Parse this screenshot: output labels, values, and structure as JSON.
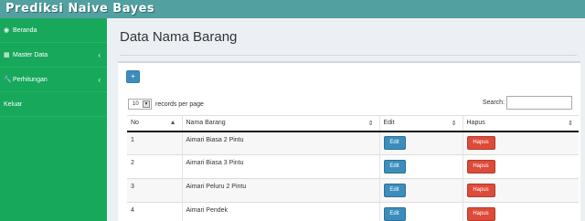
{
  "app": {
    "title": "Prediksi Naive Bayes"
  },
  "sidebar": {
    "items": [
      {
        "label": "Beranda",
        "icon": "dashboard-icon",
        "has_submenu": false
      },
      {
        "label": "Master Data",
        "icon": "table-icon",
        "has_submenu": true
      },
      {
        "label": "Perhitungan",
        "icon": "wrench-icon",
        "has_submenu": true
      },
      {
        "label": "Keluar",
        "icon": "",
        "has_submenu": false
      }
    ]
  },
  "page": {
    "title": "Data Nama Barang"
  },
  "toolbar": {
    "add_label": "+"
  },
  "datatable": {
    "length_value": "10",
    "length_label": "records per page",
    "search_label": "Search:",
    "search_value": "",
    "columns": [
      "No",
      "Nama Barang",
      "Edit",
      "Hapus"
    ],
    "rows": [
      {
        "no": "1",
        "nama": "Aimari Biasa 2 Pintu",
        "edit": "Edit",
        "hapus": "Hapus"
      },
      {
        "no": "2",
        "nama": "Aimari Biasa 3 Pintu",
        "edit": "Edit",
        "hapus": "Hapus"
      },
      {
        "no": "3",
        "nama": "Aimari Peluru 2 Pintu",
        "edit": "Edit",
        "hapus": "Hapus"
      },
      {
        "no": "4",
        "nama": "Aimari Pendek",
        "edit": "Edit",
        "hapus": "Hapus"
      }
    ]
  },
  "colors": {
    "topbar": "#52a0a0",
    "sidebar": "#17a85c",
    "primary": "#3c8dbc",
    "danger": "#dd4b39"
  }
}
